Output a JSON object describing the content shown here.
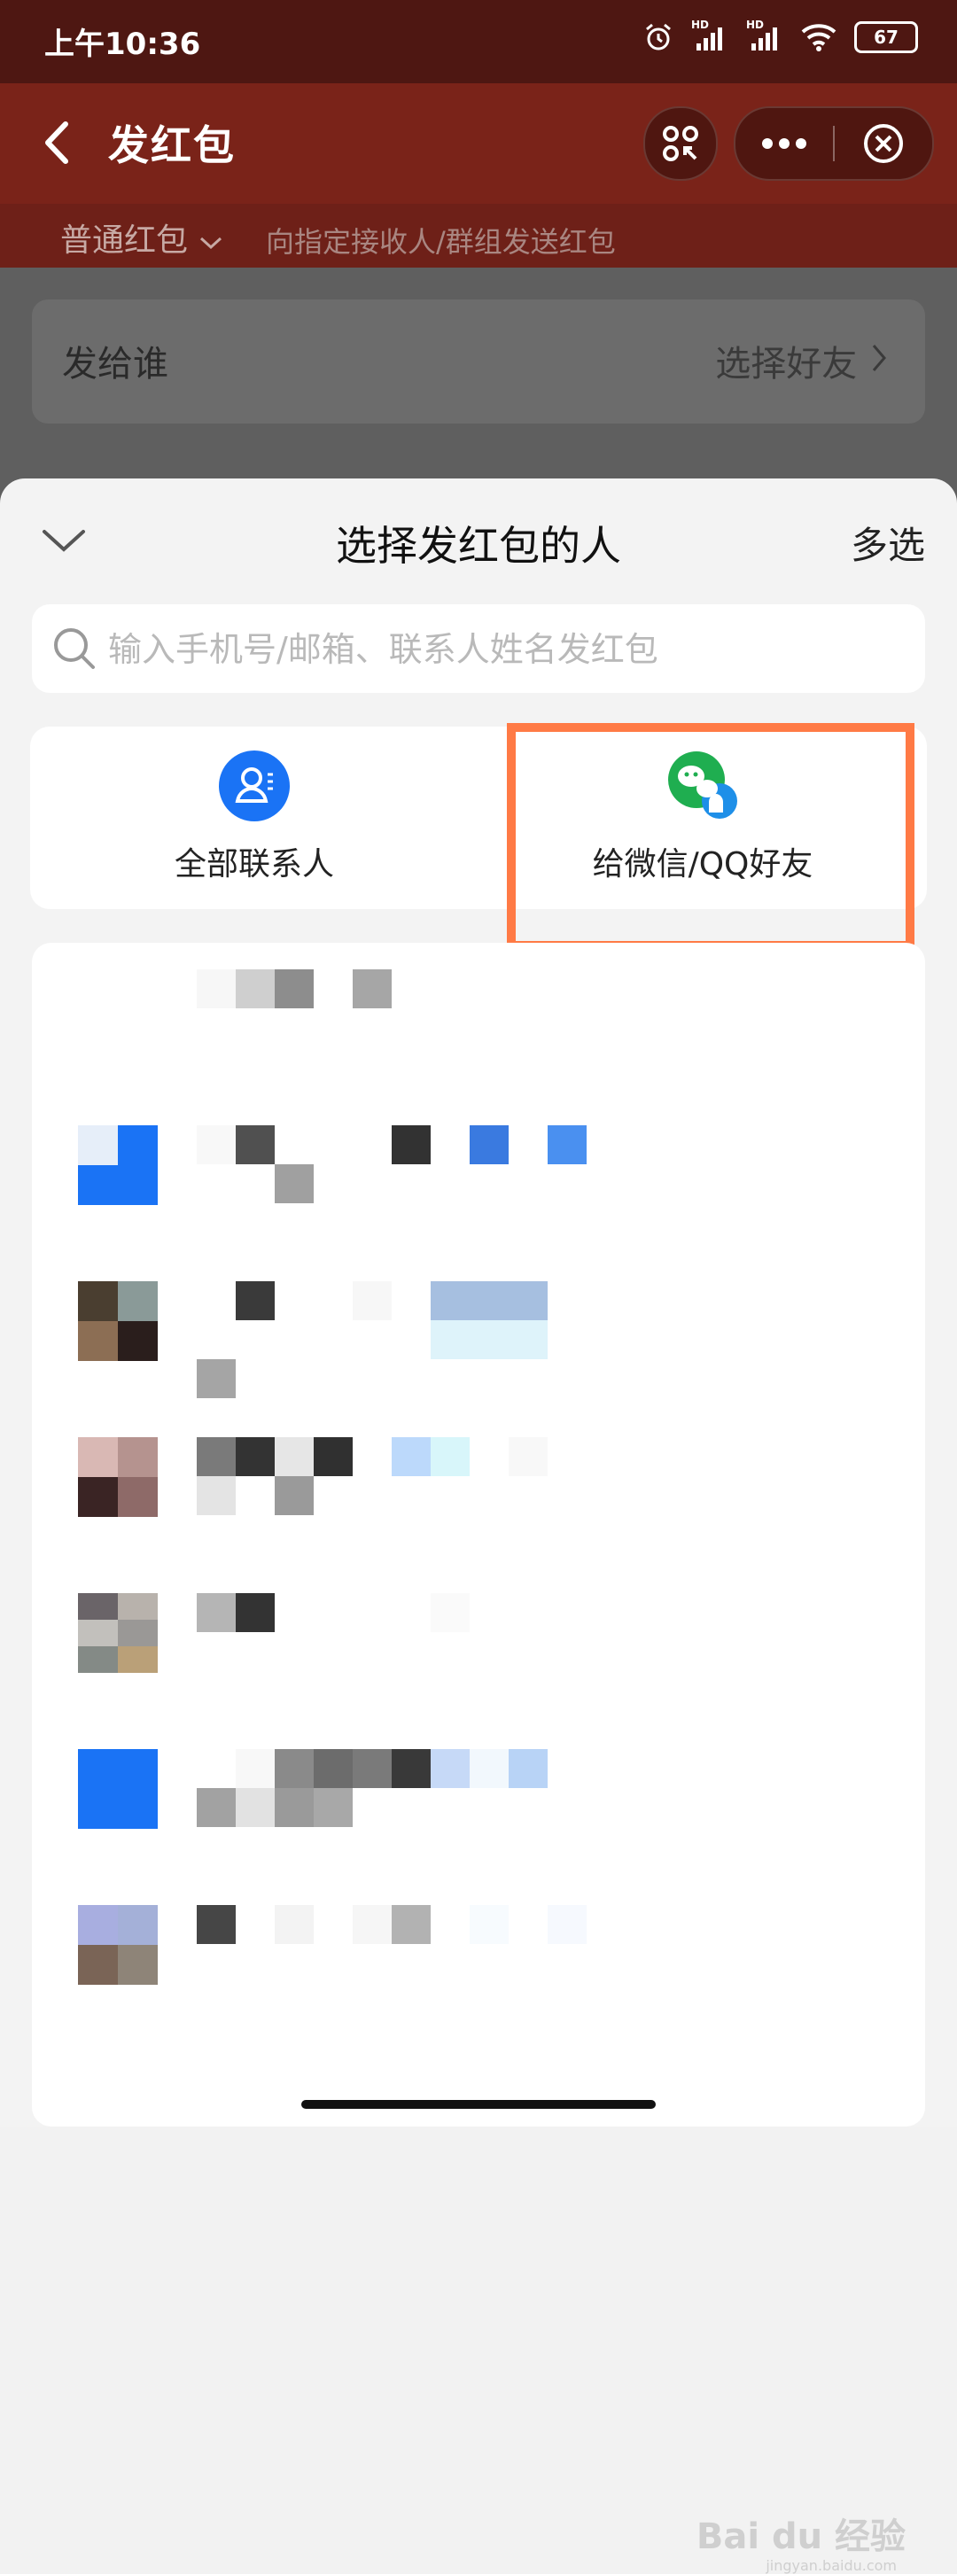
{
  "status_bar": {
    "time": "上午10:36",
    "network_1": "HD",
    "network_2": "HD",
    "battery": "67"
  },
  "app_bar": {
    "title": "发红包"
  },
  "sub_bar": {
    "type_label": "普通红包",
    "description": "向指定接收人/群组发送红包"
  },
  "background_card": {
    "label": "发给谁",
    "action": "选择好友"
  },
  "sheet": {
    "title": "选择发红包的人",
    "multi_select": "多选",
    "search_placeholder": "输入手机号/邮箱、联系人姓名发红包",
    "options": [
      {
        "label": "全部联系人",
        "icon": "contacts-icon",
        "color": "#1a73f5"
      },
      {
        "label": "给微信/QQ好友",
        "icon": "wechat-qq-icon",
        "color": "#1fae50"
      }
    ],
    "highlight_color": "#ff7a45"
  },
  "watermark": {
    "brand": "Bai du 经验",
    "url": "jingyan.baidu.com"
  }
}
